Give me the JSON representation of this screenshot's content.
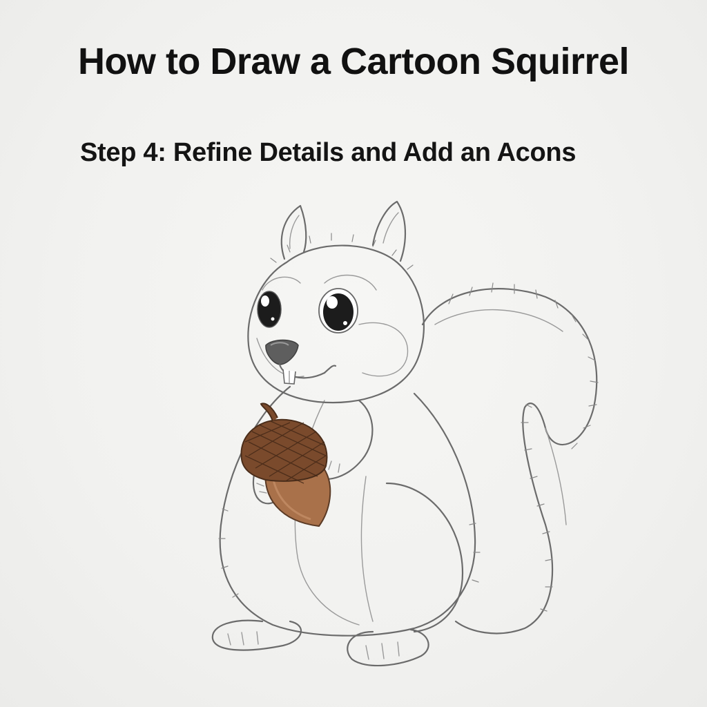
{
  "title": "How to Draw a Cartoon Squirrel",
  "subtitle": "Step 4: Refine Details and Add an Acons",
  "illustration": {
    "subject": "squirrel-icon",
    "prop": "acorn-icon",
    "colors": {
      "paper": "#f2f2f0",
      "pencil": "#6b6b6b",
      "acorn_cap": "#7a4a2c",
      "acorn_body": "#a9714a",
      "eye": "#1c1c1c",
      "nose": "#5a5a5a"
    }
  }
}
